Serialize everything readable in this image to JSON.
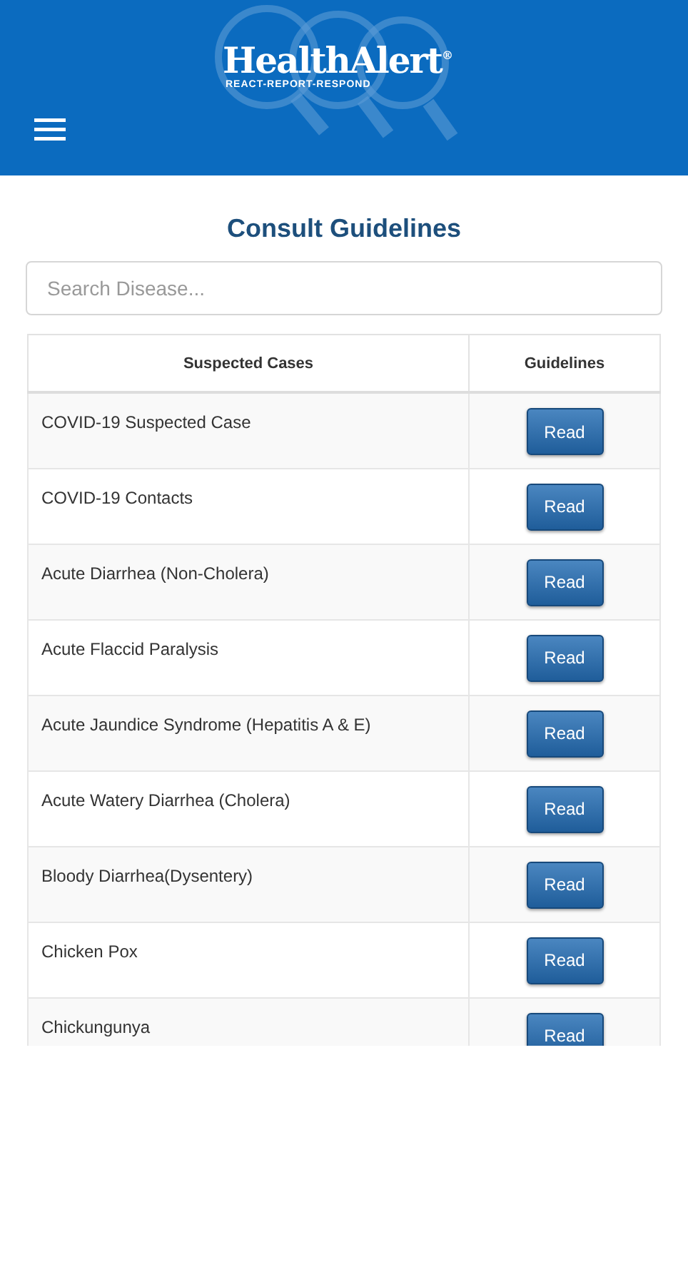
{
  "header": {
    "logo": "HealthAlert$^{®}$",
    "tagline": "REACT-REPORT-RESPOND"
  },
  "title": "Consult Guidelines",
  "search": {
    "placeholder": "Search Disease..."
  },
  "table": {
    "columns": [
      "Suspected Cases",
      "Guidelines"
    ],
    "rows": [
      {
        "name": "COVID-19 Suspected Case",
        "action": "Read"
      },
      {
        "name": "COVID-19 Contacts",
        "action": "Read"
      },
      {
        "name": "Acute Diarrhea (Non-Cholera)",
        "action": "Read"
      },
      {
        "name": "Acute Flaccid Paralysis",
        "action": "Read"
      },
      {
        "name": "Acute Jaundice Syndrome (Hepatitis A & E)",
        "action": "Read"
      },
      {
        "name": "Acute Watery Diarrhea (Cholera)",
        "action": "Read"
      },
      {
        "name": "Bloody Diarrhea(Dysentery)",
        "action": "Read"
      },
      {
        "name": "Chicken Pox",
        "action": "Read"
      },
      {
        "name": "Chickungunya",
        "action": "Read"
      }
    ]
  }
}
